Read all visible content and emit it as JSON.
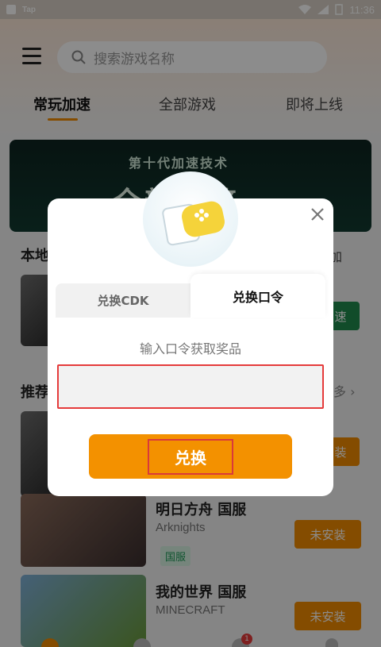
{
  "status_bar": {
    "app_name": "Tap",
    "time": "11:36"
  },
  "header": {
    "search_placeholder": "搜索游戏名称"
  },
  "tabs": [
    {
      "label": "常玩加速"
    },
    {
      "label": "全部游戏"
    },
    {
      "label": "即将上线"
    }
  ],
  "banner": {
    "title": "第十代加速技术",
    "subtitle": "全新引擎"
  },
  "sections": {
    "local_title": "本地",
    "rec_title": "推荐",
    "more": "多 ›",
    "local_side_label": "加",
    "local_button_label": "速"
  },
  "games": [
    {
      "title": "明日方舟 国服",
      "subtitle": "Arknights",
      "tag": "国服",
      "button": "未安装"
    },
    {
      "title": "我的世界 国服",
      "subtitle": "MINECRAFT",
      "button": "未安装"
    }
  ],
  "partial_install_label": "装",
  "dialog": {
    "tab_cdk": "兑换CDK",
    "tab_command": "兑换口令",
    "hint": "输入口令获取奖品",
    "input_value": "",
    "submit": "兑换"
  },
  "badge_count": "1",
  "colors": {
    "accent": "#f39100",
    "highlight_red": "#e53b3b",
    "tag_green": "#1d9a57"
  }
}
